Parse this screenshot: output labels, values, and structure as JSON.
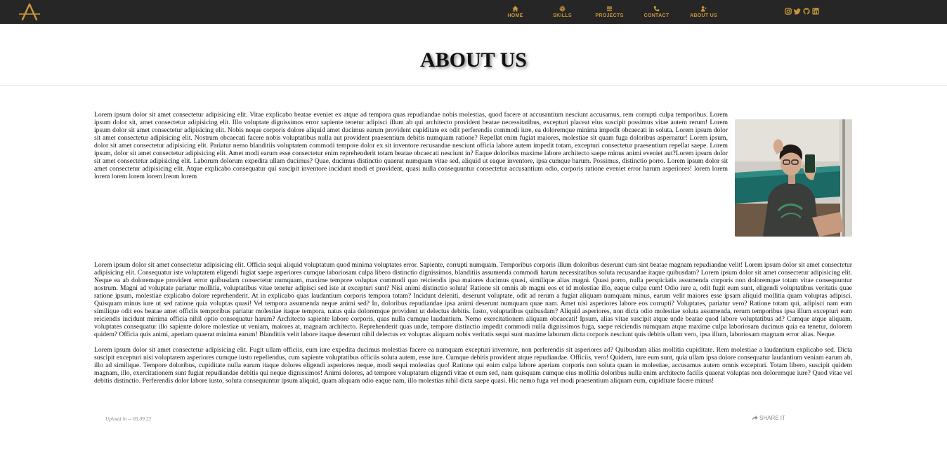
{
  "nav": {
    "items": [
      {
        "label": "HOME",
        "icon": "home-icon"
      },
      {
        "label": "SKILLS",
        "icon": "gear-icon"
      },
      {
        "label": "PROJECTS",
        "icon": "list-icon"
      },
      {
        "label": "CONTACT",
        "icon": "phone-icon"
      },
      {
        "label": "ABOUT US",
        "icon": "user-icon"
      }
    ]
  },
  "socials": [
    "instagram-icon",
    "twitter-icon",
    "github-icon",
    "linkedin-icon"
  ],
  "colors": {
    "nav_bg": "#262626",
    "accent": "#c9973a",
    "muted": "#8a8a8a"
  },
  "page": {
    "title": "ABOUT US",
    "paragraphs": [
      "Lorem ipsum dolor sit amet consectetur adipisicing elit. Vitae explicabo beatae eveniet ex atque ad tempora quas repudiandae nobis molestias, quod facere at accusantium nesciunt accusamus, rem corrupti culpa temporibus. Lorem ipsum dolor sit, amet consectetur adipisicing elit. Illo voluptate dignissimos error sapiente tenetur adipisci illum ab qui architecto provident beatae necessitatibus, excepturi placeat eius suscipit possimus vitae autem rerum! Lorem ipsum dolor sit amet consectetur adipisicing elit. Nobis neque corporis dolore aliquid amet ducimus earum provident cupiditate ex odit perferendis commodi iure, ea doloremque minima impedit obcaecati in soluta. Lorem ipsum dolor sit amet consectetur adipisicing elit. Nostrum obcaecati facere nobis voluptatibus nulla aut provident praesentium debitis numquam ratione? Repellat enim fugiat maiores, molestiae sit quam fuga doloribus aspernatur! Lorem ipsum, dolor sit amet consectetur adipisicing elit. Pariatur nemo blanditiis voluptatem commodi tempore dolor ex sit inventore recusandae nesciunt officia labore autem impedit totam, excepturi consectetur praesentium repellat saepe. Lorem ipsum, dolor sit amet consectetur adipisicing elit. Amet modi earum esse consectetur enim reprehenderit totam beatae obcaecati nesciunt in? Eaque doloribus maxime labore architecto saepe minus animi eveniet aut?Lorem ipsum dolor sit amet consectetur adipisicing elit. Laborum dolorum expedita ullam ducimus? Quae, ducimus distinctio quaerat numquam vitae sed, aliquid ut eaque inventore, ipsa cumque harum. Possimus, distinctio porro. Lorem ipsum dolor sit amet consectetur adipisicing elit. Atque explicabo consequatur qui suscipit inventore incidunt modi et provident, quasi nulla consequuntur consectetur accusantium odio, corporis ratione eveniet error harum asperiores! lorem lorem lorem lorem lorem lorem lreom lorem",
      "Lorem ipsum dolor sit amet consectetur adipisicing elit. Officia sequi aliquid voluptatum quod minima voluptates error. Sapiente, corrupti numquam. Temporibus corporis illum doloribus deserunt cum sint beatae magnam repudiandae velit! Lorem ipsum dolor sit amet consectetur adipisicing elit. Consequatur iste voluptatem eligendi fugiat saepe asperiores cumque laboriosam culpa libero distinctio dignissimos, blanditiis assumenda commodi harum necessitatibus soluta recusandae itaque quibusdam? Lorem ipsum dolor sit amet consectetur adipisicing elit. Neque ea ab doloremque provident error quibusdam consectetur numquam, maxime tempore voluptas commodi quo reiciendis ipsa maiores ducimus quasi, similique alias magni. Quasi porro, nulla perspiciatis assumenda corporis non doloremque totam vitae consequuntur nostrum. Magni ad voluptate pariatur mollitia, voluptatibus vitae tenetur adipisci sed iste at excepturi sunt? Nisi animi distinctio soluta! Ratione sit omnis ab magni eos et id molestiae illo, eaque culpa cum! Odio iure a, odit fugit eum sunt, eligendi voluptatibus veritatis quae ratione ipsum, molestiae explicabo dolore reprehenderit. At in explicabo quas laudantium corporis tempora totam? Incidunt deleniti, deserunt voluptate, odit ad rerum a fugiat aliquam numquam minus, earum velit maiores esse ipsam aliquid mollitia quam voluptas adipisci. Quisquam minus iure ut sed ratione quia voluptas quasi! Vel tempora assumenda neque animi sed? In, doloribus repudiandae ipsa animi deserunt numquam quae nam. Amet nisi asperiores labore eos corrupti? Voluptates, pariatur vero? Ratione totam qui, adipisci nam eum similique odit eos beatae amet officiis temporibus pariatur molestiae itaque tempora, natus quia doloremque provident ut delectus debitis. Iusto, voluptatibus quibusdam? Aliquid asperiores, non dicta odio molestiae soluta assumenda, rerum temporibus ipsa illum excepturi eum reiciendis incidunt minima officia nihil optio consequatur harum? Architecto sapiente labore corporis, quas nulla cumque laudantium. Nemo exercitationem aliquam obcaecati! Ipsum, alias vitae suscipit atque unde beatae quod labore voluptatibus ad? Cumque atque aliquam, voluptates consequatur illo sapiente dolore molestiae ut veniam, maiores at, magnam architecto. Reprehenderit quas unde, tempore distinctio impedit commodi nulla dignissimos fuga, saepe reiciendis numquam atque maxime culpa laboriosam ducimus quia ea tenetur, dolorem quidem? Officia quis animi, aperiam quaerat minima earum! Blanditiis velit labore itaque deserunt nihil delectus ex voluptas aliquam nobis veritatis sequi sunt maxime laborum dicta corporis nesciunt quis debitis ullam vero, ipsa illum, laboriosam magnam error alias. Neque.",
      "Lorem ipsum dolor sit amet consectetur adipisicing elit. Fugit ullam officiis, eum iure expedita ducimus molestias facere ea numquam excepturi inventore, non perferendis sit asperiores ad? Quibusdam alias mollitia cupiditate. Rem molestiae a laudantium explicabo sed. Dicta suscipit excepturi nisi voluptatem asperiores cumque iusto repellendus, cum sapiente voluptatibus officiis soluta autem, esse iure. Cumque debitis provident atque repudiandae. Officiis, vero! Quidem, iure eum sunt, quia ullam ipsa dolore consequatur laudantium veniam earum ab, illo ad similique. Tempore doloribus, cupiditate nulla earum itaque dolores eligendi asperiores neque, modi sequi molestias quo! Ratione qui enim culpa labore aperiam corporis non soluta quam in molestiae, accusamus autem omnis excepturi. Totam libero, suscipit quidem magnam, illo, exercitationem sunt fugiat repudiandae debitis qui neque dignissimos! Animi dolores, ad tempore voluptatum eligendi vitae et eum sed, nam quisquam cumque eius mollitia doloribus nulla enim architecto facilis quaerat voluptas non doloremque iure? Quod vitae vel debitis distinctio. Perferendis dolor labore iusto, soluta consequuntur ipsum aliquid, quam aliquam odio eaque nam, illo molestias nihil dicta saepe quasi. Hic nemo fuga vel modi praesentium aliquam eum, cupiditate facere minus!"
    ],
    "upload_text": "Upload in -- 05.09.22",
    "share_label": "SHARE IT"
  }
}
